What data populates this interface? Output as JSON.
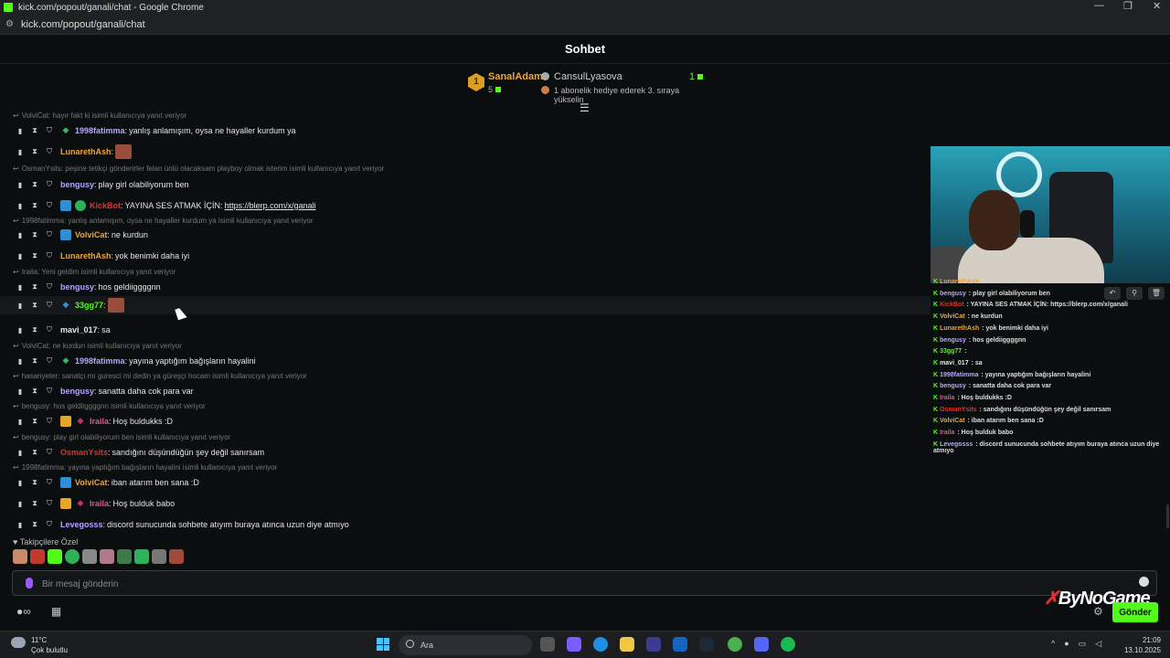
{
  "window": {
    "title": "kick.com/popout/ganali/chat - Google Chrome",
    "url": "kick.com/popout/ganali/chat",
    "controls": [
      "—",
      "❐",
      "✕"
    ]
  },
  "chat": {
    "header": "Sohbet",
    "leaderboard": {
      "first": {
        "rank": "1",
        "name": "SanalAdam",
        "count": "5"
      },
      "second": {
        "name": "CansulLyasova",
        "note": "1 abonelik hediye ederek 3. sıraya yükselin"
      },
      "right_count": "1"
    },
    "messages": [
      {
        "type": "reply",
        "text": "VolviCat: hayır fakt ki isimli kullanıcıya yanıt veriyor"
      },
      {
        "type": "msg",
        "badges": [
          "sub-green"
        ],
        "name": "1998fatimma",
        "color": "#b9a4ff",
        "text": "yanlış anlamışım, oysa ne hayaller kurdum ya"
      },
      {
        "type": "msg",
        "badges": [],
        "name": "LunarethAsh",
        "color": "#e8a640",
        "text": "",
        "emote": true
      },
      {
        "type": "reply",
        "text": "OsmanYsits: peşine tetikçi gönderirler felan ünlü olacaksam playboy olmak isterim isimli kullanıcıya yanıt veriyor"
      },
      {
        "type": "msg",
        "badges": [],
        "name": "bengusy",
        "color": "#b9a4ff",
        "text": "play girl olabiliyorum ben"
      },
      {
        "type": "msg",
        "badges": [
          "blue",
          "green"
        ],
        "name": "KickBot",
        "color": "#e2302d",
        "text": "YAYINA SES ATMAK İÇİN:",
        "link": "https://blerp.com/x/ganali"
      },
      {
        "type": "reply",
        "text": "1998fatimma: yanlış anlamışım, oysa ne hayaller kurdum ya isimli kullanıcıya yanıt veriyor"
      },
      {
        "type": "msg",
        "badges": [
          "blue"
        ],
        "name": "VolviCat",
        "color": "#e8a640",
        "text": "ne kurdun"
      },
      {
        "type": "msg",
        "badges": [],
        "name": "LunarethAsh",
        "color": "#e8a640",
        "text": "yok benimki daha iyi"
      },
      {
        "type": "reply",
        "text": "Iraila: Yeni geldim isimli kullanıcıya yanıt veriyor"
      },
      {
        "type": "msg",
        "badges": [],
        "name": "bengusy",
        "color": "#b9a4ff",
        "text": "hos geldiiggggnn"
      },
      {
        "type": "msg",
        "badges": [
          "sub-blue"
        ],
        "name": "33gg77",
        "color": "#53fc18",
        "text": "",
        "emote": true,
        "highlight": true
      },
      {
        "type": "msg",
        "badges": [],
        "name": "mavi_017",
        "color": "#e6e6e6",
        "text": "sa"
      },
      {
        "type": "reply",
        "text": "VolviCat: ne kurdun isimli kullanıcıya yanıt veriyor"
      },
      {
        "type": "msg",
        "badges": [
          "sub-green"
        ],
        "name": "1998fatimma",
        "color": "#b9a4ff",
        "text": "yayına yaptığım bağışların hayalini"
      },
      {
        "type": "reply",
        "text": "hasanyeter: sanatçı mı guresci mi dedin ya güreşçi hocam isimli kullanıcıya yanıt veriyor"
      },
      {
        "type": "msg",
        "badges": [],
        "name": "bengusy",
        "color": "#b9a4ff",
        "text": "sanatta daha cok para var"
      },
      {
        "type": "reply",
        "text": "bengusy: hos geldiiggggnn isimli kullanıcıya yanıt veriyor"
      },
      {
        "type": "msg",
        "badges": [
          "gold",
          "sub-red"
        ],
        "name": "Iraila",
        "color": "#e0578f",
        "text": "Hoş buldukks :D"
      },
      {
        "type": "reply",
        "text": "bengusy: play girl olabiliyorum ben isimli kullanıcıya yanıt veriyor"
      },
      {
        "type": "msg",
        "badges": [],
        "name": "OsmanYsits",
        "color": "#e2302d",
        "text": "sandığını düşündüğün şey değil sanırsam"
      },
      {
        "type": "reply",
        "text": "1998fatimma: yayına yaptığım bağışların hayalini isimli kullanıcıya yanıt veriyor"
      },
      {
        "type": "msg",
        "badges": [
          "blue"
        ],
        "name": "VolviCat",
        "color": "#e8a640",
        "text": "iban atarım ben sana :D"
      },
      {
        "type": "msg",
        "badges": [
          "gold",
          "sub-red"
        ],
        "name": "Iraila",
        "color": "#e0578f",
        "text": "Hoş bulduk babo"
      },
      {
        "type": "msg",
        "badges": [],
        "name": "Levegosss",
        "color": "#b9a4ff",
        "text": "discord sunucunda sohbete atıyım buraya atınca uzun diye atmıyo"
      }
    ],
    "special_label": "Takipçilere Özel",
    "input_placeholder": "Bir mesaj gönderin",
    "send_label": "Gönder"
  },
  "overlay": {
    "rows": [
      {
        "name": "LunarethAsh",
        "color": "#e8a640",
        "text": ""
      },
      {
        "name": "bengusy",
        "color": "#b9a4ff",
        "text": "play girl olabiliyorum ben"
      },
      {
        "name": "KickBot",
        "color": "#e2302d",
        "text": "YAYINA SES ATMAK İÇİN: https://blerp.com/x/ganali"
      },
      {
        "name": "VolviCat",
        "color": "#e8a640",
        "text": "ne kurdun"
      },
      {
        "name": "LunarethAsh",
        "color": "#e8a640",
        "text": "yok benimki daha iyi"
      },
      {
        "name": "bengusy",
        "color": "#b9a4ff",
        "text": "hos geldiiggggnn"
      },
      {
        "name": "33gg77",
        "color": "#53fc18",
        "text": ""
      },
      {
        "name": "mavi_017",
        "color": "#e6e6e6",
        "text": "sa"
      },
      {
        "name": "1998fatimma",
        "color": "#b9a4ff",
        "text": "yayına yaptığım bağışların hayalini"
      },
      {
        "name": "bengusy",
        "color": "#b9a4ff",
        "text": "sanatta daha cok para var"
      },
      {
        "name": "Iraila",
        "color": "#e0578f",
        "text": "Hoş buldukks :D"
      },
      {
        "name": "OsmanYsits",
        "color": "#e2302d",
        "text": "sandığını düşündüğün şey değil sanırsam"
      },
      {
        "name": "VolviCat",
        "color": "#e8a640",
        "text": "iban atarım ben sana :D"
      },
      {
        "name": "Iraila",
        "color": "#e0578f",
        "text": "Hoş bulduk babo"
      },
      {
        "name": "Levegosss",
        "color": "#b9a4ff",
        "text": "discord sunucunda sohbete atıyım buraya atınca uzun diye atmıyo"
      }
    ],
    "brand": "ByNoGame"
  },
  "taskbar": {
    "weather_temp": "11°C",
    "weather_desc": "Çok bulutlu",
    "search_label": "Ara",
    "time": "21:09",
    "date": "13.10.2025"
  },
  "colors": {
    "kick_green": "#53fc18",
    "background": "#0b0e0f"
  }
}
